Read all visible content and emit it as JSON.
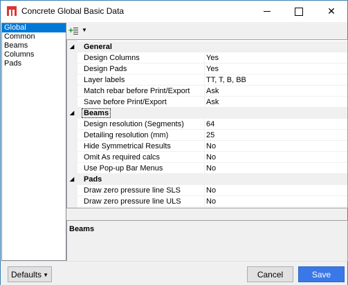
{
  "window": {
    "title": "Concrete Global Basic Data",
    "close_glyph": "✕"
  },
  "nav": {
    "items": [
      {
        "label": "Global",
        "selected": true
      },
      {
        "label": "Common"
      },
      {
        "label": "Beams"
      },
      {
        "label": "Columns"
      },
      {
        "label": "Pads"
      }
    ]
  },
  "toolbar": {
    "add_icon": "add-list-icon",
    "dropdown_glyph": "▼"
  },
  "grid": {
    "categories": [
      {
        "label": "General",
        "glyph": "◢",
        "properties": [
          {
            "name": "Design Columns",
            "value": "Yes"
          },
          {
            "name": "Design Pads",
            "value": "Yes"
          },
          {
            "name": "Layer labels",
            "value": "TT, T, B, BB"
          },
          {
            "name": "Match rebar before Print/Export",
            "value": "Ask"
          },
          {
            "name": "Save before Print/Export",
            "value": "Ask"
          }
        ]
      },
      {
        "label": "Beams",
        "glyph": "◢",
        "properties": [
          {
            "name": "Design resolution (Segments)",
            "value": "64"
          },
          {
            "name": "Detailing resolution (mm)",
            "value": "25"
          },
          {
            "name": "Hide Symmetrical Results",
            "value": "No"
          },
          {
            "name": "Omit As required calcs",
            "value": "No"
          },
          {
            "name": "Use Pop-up Bar Menus",
            "value": "No"
          }
        ]
      },
      {
        "label": "Pads",
        "glyph": "◢",
        "properties": [
          {
            "name": "Draw zero pressure line SLS",
            "value": "No"
          },
          {
            "name": "Draw zero pressure line ULS",
            "value": "No"
          }
        ]
      }
    ]
  },
  "description": {
    "title": "Beams"
  },
  "buttons": {
    "defaults": "Defaults",
    "defaults_arrow": "▼",
    "cancel": "Cancel",
    "save": "Save"
  }
}
